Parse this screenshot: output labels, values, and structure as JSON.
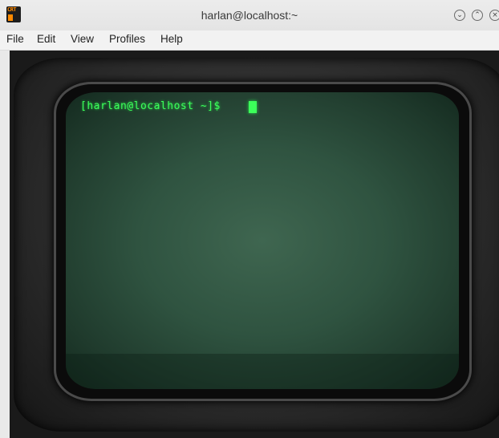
{
  "window": {
    "title": "harlan@localhost:~",
    "icon_label": "CRT"
  },
  "menu": {
    "items": [
      "File",
      "Edit",
      "View",
      "Profiles",
      "Help"
    ]
  },
  "terminal": {
    "prompt": "[harlan@localhost ~]$ ",
    "text_color": "#3cff5a",
    "screen_color": "#2f5340"
  },
  "controls": {
    "minimize_icon": "chevron-down-icon",
    "maximize_icon": "chevron-up-icon",
    "close_icon": "close-icon"
  }
}
